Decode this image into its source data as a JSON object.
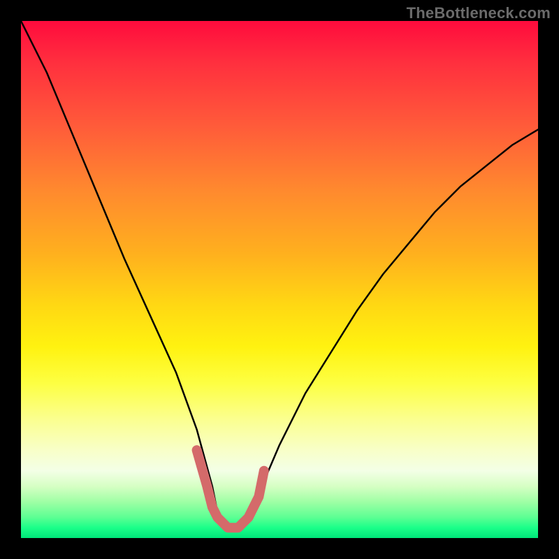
{
  "watermark": "TheBottleneck.com",
  "chart_data": {
    "type": "line",
    "title": "",
    "xlabel": "",
    "ylabel": "",
    "xlim": [
      0,
      100
    ],
    "ylim": [
      0,
      100
    ],
    "grid": false,
    "legend": false,
    "series": [
      {
        "name": "bottleneck-curve-normalized",
        "x": [
          0,
          5,
          10,
          15,
          20,
          25,
          30,
          34,
          37,
          38,
          40,
          42,
          44,
          47,
          50,
          55,
          60,
          65,
          70,
          75,
          80,
          85,
          90,
          95,
          100
        ],
        "y": [
          100,
          90,
          78,
          66,
          54,
          43,
          32,
          21,
          10,
          5,
          2,
          2,
          5,
          11,
          18,
          28,
          36,
          44,
          51,
          57,
          63,
          68,
          72,
          76,
          79
        ]
      }
    ],
    "highlight": {
      "name": "low-bottleneck-zone",
      "x": [
        34,
        36,
        37,
        38,
        40,
        42,
        44,
        46,
        47
      ],
      "y": [
        17,
        10,
        6,
        4,
        2,
        2,
        4,
        8,
        13
      ]
    }
  },
  "colors": {
    "curve": "#000000",
    "highlight": "#d46a6a",
    "gradient_top": "#ff0b3d",
    "gradient_mid": "#fff210",
    "gradient_bottom": "#00e67a",
    "frame": "#000000",
    "watermark": "#6b6b6b"
  }
}
